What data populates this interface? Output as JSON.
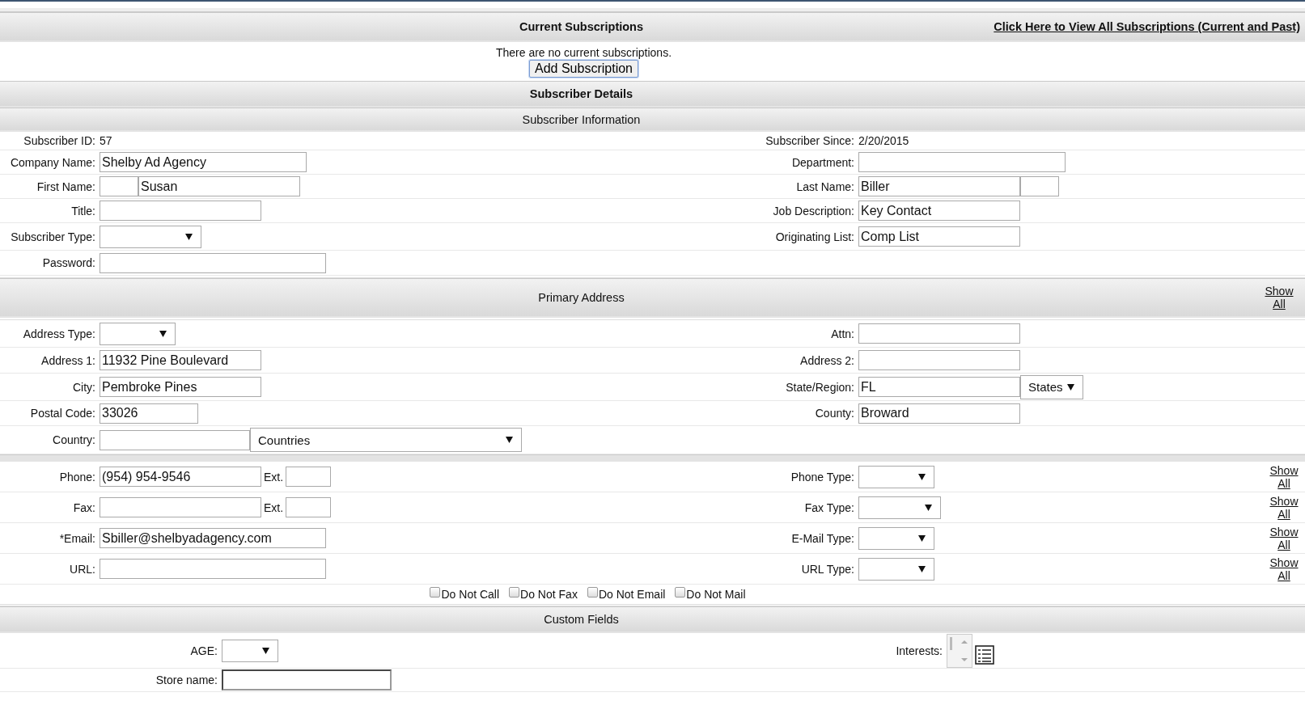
{
  "subscriptions": {
    "title": "Current Subscriptions",
    "view_all_link": "Click Here to View All Subscriptions (Current and Past)",
    "message": "There are no current subscriptions.",
    "add_button": "Add Subscription"
  },
  "details_title": "Subscriber Details",
  "info": {
    "title": "Subscriber Information",
    "rows": [
      {
        "left": {
          "label": "Subscriber ID:",
          "kind": "static",
          "value": "57"
        },
        "right": {
          "label": "Subscriber Since:",
          "kind": "static",
          "value": "2/20/2015"
        }
      },
      {
        "left": {
          "label": "Company Name:",
          "kind": "input",
          "value": "Shelby Ad Agency"
        },
        "right": {
          "label": "Department:",
          "kind": "input"
        }
      },
      {
        "left": {
          "label": "First Name:",
          "kind": "prefixed_input",
          "value": "Susan"
        },
        "right": {
          "label": "Last Name:",
          "kind": "suffixed_input",
          "value": "Biller"
        }
      },
      {
        "left": {
          "label": "Title:",
          "kind": "input"
        },
        "right": {
          "label": "Job Description:",
          "kind": "input",
          "value": "Key Contact"
        }
      },
      {
        "left": {
          "label": "Subscriber Type:",
          "kind": "select"
        },
        "right": {
          "label": "Originating List:",
          "kind": "input",
          "value": "Comp List"
        }
      },
      {
        "left": {
          "label": "Password:",
          "kind": "input"
        }
      }
    ]
  },
  "address": {
    "title": "Primary Address",
    "show_all": "Show All",
    "rows": [
      {
        "left": {
          "label": "Address Type:",
          "kind": "select"
        },
        "right": {
          "label": "Attn:",
          "kind": "input"
        }
      },
      {
        "left": {
          "label": "Address 1:",
          "kind": "input",
          "value": "11932 Pine Boulevard"
        },
        "right": {
          "label": "Address 2:",
          "kind": "input"
        }
      },
      {
        "left": {
          "label": "City:",
          "kind": "input",
          "value": "Pembroke Pines"
        },
        "right": {
          "label": "State/Region:",
          "kind": "input_select",
          "value": "FL",
          "select_value": "States"
        }
      },
      {
        "left": {
          "label": "Postal Code:",
          "kind": "input",
          "value": "33026"
        },
        "right": {
          "label": "County:",
          "kind": "input",
          "value": "Broward"
        }
      },
      {
        "left": {
          "label": "Country:",
          "kind": "input_select",
          "select_value": "Countries"
        }
      }
    ]
  },
  "contact": {
    "rows": [
      {
        "left": {
          "label": "Phone:",
          "kind": "input_ext",
          "value": "(954) 954-9546",
          "ext_label": "Ext."
        },
        "right": {
          "label": "Phone Type:",
          "kind": "select"
        },
        "show_all": "Show All"
      },
      {
        "left": {
          "label": "Fax:",
          "kind": "input_ext",
          "ext_label": "Ext."
        },
        "right": {
          "label": "Fax Type:",
          "kind": "select"
        },
        "show_all": "Show All"
      },
      {
        "left": {
          "label": "*Email:",
          "kind": "input",
          "value": "Sbiller@shelbyadagency.com"
        },
        "right": {
          "label": "E-Mail Type:",
          "kind": "select"
        },
        "show_all": "Show All"
      },
      {
        "left": {
          "label": "URL:",
          "kind": "input"
        },
        "right": {
          "label": "URL Type:",
          "kind": "select"
        },
        "show_all": "Show All"
      }
    ],
    "options": [
      {
        "label": "Do Not Call",
        "checked": false
      },
      {
        "label": "Do Not Fax",
        "checked": false
      },
      {
        "label": "Do Not Email",
        "checked": false
      },
      {
        "label": "Do Not Mail",
        "checked": false
      }
    ]
  },
  "custom": {
    "title": "Custom Fields",
    "rows": [
      {
        "left": {
          "label": "AGE:",
          "kind": "select"
        },
        "right": {
          "label": "Interests:",
          "kind": "listbox"
        }
      },
      {
        "left": {
          "label": "Store name:",
          "kind": "inset_input"
        }
      }
    ]
  }
}
